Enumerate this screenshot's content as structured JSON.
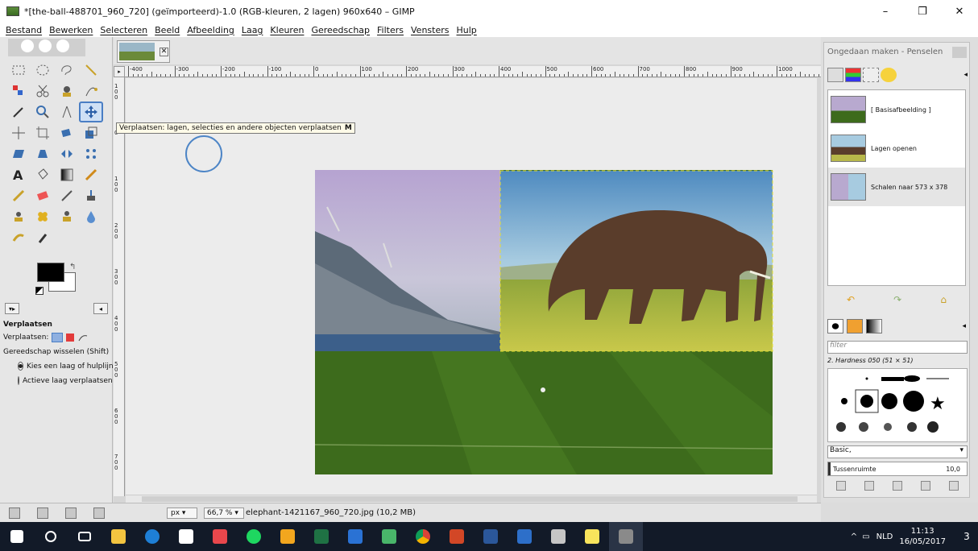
{
  "window": {
    "title": "*[the-ball-488701_960_720] (geïmporteerd)-1.0 (RGB-kleuren, 2 lagen) 960x640 – GIMP",
    "minimize": "–",
    "maximize": "❐",
    "close": "✕"
  },
  "menu": [
    "Bestand",
    "Bewerken",
    "Selecteren",
    "Beeld",
    "Afbeelding",
    "Laag",
    "Kleuren",
    "Gereedschap",
    "Filters",
    "Vensters",
    "Hulp"
  ],
  "tooltip": {
    "text": "Verplaatsen: lagen, selecties en andere objecten verplaatsen",
    "shortcut": "M"
  },
  "tool_options": {
    "heading": "Verplaatsen",
    "move_label": "Verplaatsen:",
    "switch_label": "Gereedschap wisselen (Shift)",
    "options": [
      "Kies een laag of hulplijn",
      "Actieve laag verplaatsen"
    ],
    "selected_index": 0
  },
  "ruler": {
    "top_labels": [
      "-400",
      "-300",
      "-200",
      "-100",
      "0",
      "100",
      "200",
      "300",
      "400",
      "500",
      "600",
      "700",
      "800",
      "900",
      "1000"
    ],
    "left_labels": [
      "100",
      "0",
      "100",
      "200",
      "300",
      "400",
      "500",
      "600",
      "700"
    ]
  },
  "status": {
    "unit": "px",
    "zoom": "66,7 %",
    "file": "elephant-1421167_960_720.jpg (10,2 MB)"
  },
  "dock": {
    "title": "Ongedaan maken - Penselen",
    "undo_items": [
      "[ Basisafbeelding ]",
      "Lagen openen",
      "Schalen naar 573 x 378"
    ],
    "selected_undo": 2,
    "filter_placeholder": "filter",
    "brush_name": "2. Hardness 050 (51 × 51)",
    "brush_preset": "Basic,",
    "spacing_label": "Tussenruimte",
    "spacing_value": "10,0"
  },
  "taskbar": {
    "language": "NLD",
    "time": "11:13",
    "date": "16/05/2017",
    "notifications": "3"
  },
  "icons": {
    "move_tool": "move-icon",
    "ball": "football"
  },
  "colors": {
    "sky_left": "#b8a9cf",
    "grass": "#3d6b1c",
    "taskbar": "#121a28",
    "accent": "#4d85c6"
  }
}
